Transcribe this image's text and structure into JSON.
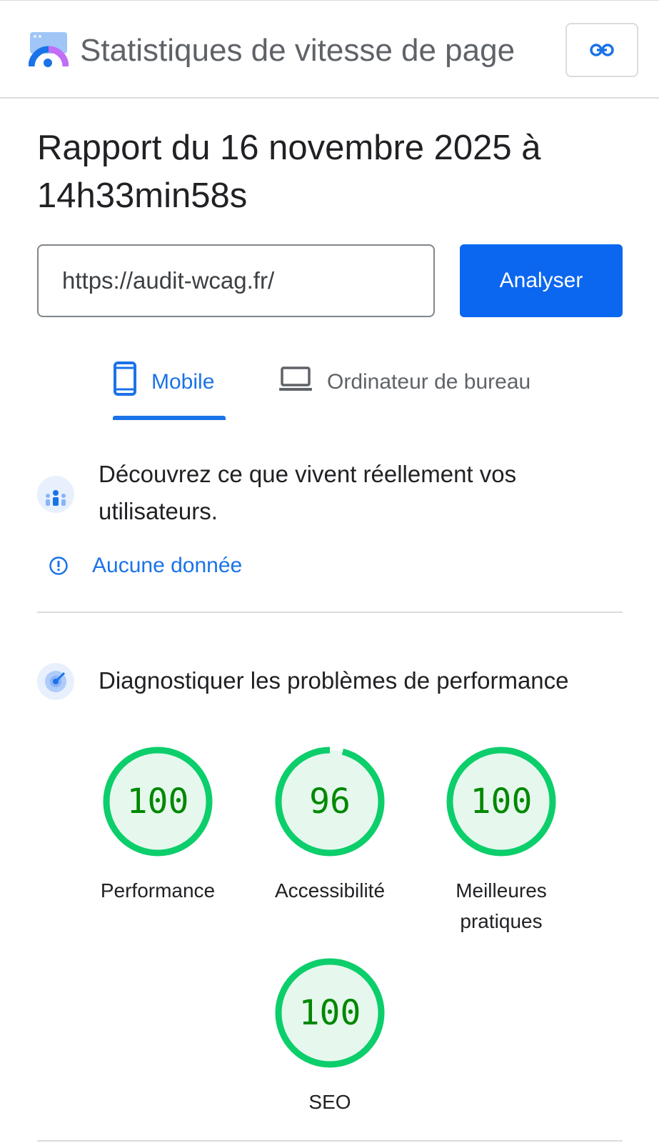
{
  "header": {
    "title": "Statistiques de vitesse de page",
    "logo_icon": "pagespeed-logo-icon",
    "link_icon": "link-icon"
  },
  "report": {
    "title": "Rapport du 16 novembre 2025 à 14h33min58s"
  },
  "search": {
    "url_value": "https://audit-wcag.fr/",
    "analyse_label": "Analyser"
  },
  "tabs": [
    {
      "label": "Mobile",
      "icon": "phone-icon",
      "selected": true
    },
    {
      "label": "Ordinateur de bureau",
      "icon": "laptop-icon",
      "selected": false
    }
  ],
  "crux": {
    "heading": "Découvrez ce que vivent réellement vos utilisateurs.",
    "no_data_label": "Aucune donnée"
  },
  "diagnostics": {
    "heading": "Diagnostiquer les problèmes de performance"
  },
  "scores": [
    {
      "label": "Performance",
      "score": "100",
      "value": 100
    },
    {
      "label": "Accessibilité",
      "score": "96",
      "value": 96
    },
    {
      "label": "Meilleures pratiques",
      "score": "100",
      "value": 100
    },
    {
      "label": "SEO",
      "score": "100",
      "value": 100
    }
  ],
  "colors": {
    "accent": "#1a73e8",
    "button": "#0b67f0",
    "good": "#0cce6b",
    "good_fill": "#e6f8ee",
    "good_text": "#008800"
  }
}
